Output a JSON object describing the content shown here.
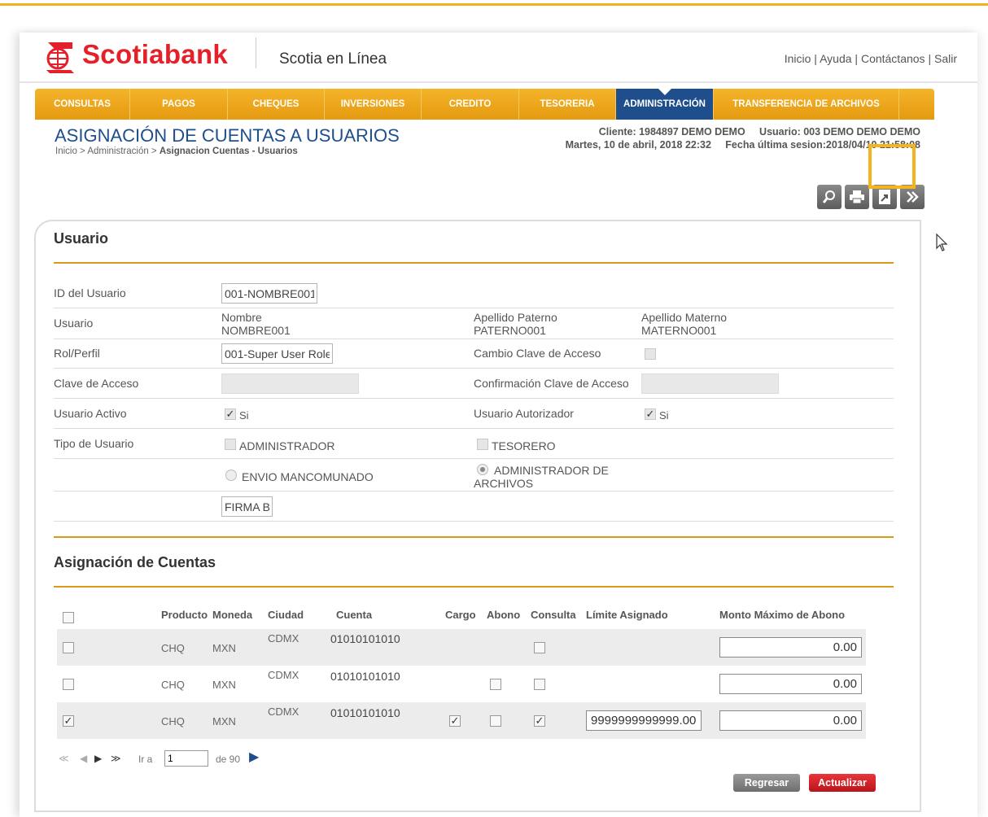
{
  "header": {
    "brand": "Scotiabank",
    "app_title": "Scotia en Línea",
    "links": [
      "Inicio",
      "Ayuda",
      "Contáctanos",
      "Salir"
    ],
    "link_sep": " | "
  },
  "nav": {
    "items": [
      "CONSULTAS",
      "PAGOS",
      "CHEQUES",
      "INVERSIONES",
      "CREDITO",
      "TESORERIA",
      "ADMINISTRACIÓN",
      "TRANSFERENCIA DE ARCHIVOS"
    ],
    "active": "ADMINISTRACIÓN"
  },
  "page": {
    "title": "ASIGNACIÓN DE CUENTAS A USUARIOS",
    "breadcrumb_prefix": "Inicio > Administración > ",
    "breadcrumb_current": "Asignacion Cuentas - Usuarios",
    "session_line1": "Cliente: 1984897 DEMO DEMO     Usuario: 003 DEMO DEMO DEMO",
    "session_line2": "Martes, 10 de abril, 2018 22:32     Fecha última sesion:2018/04/10 21:58:08"
  },
  "toolbar": {
    "icons": [
      "search-icon",
      "print-icon",
      "export-icon",
      "next-icon"
    ]
  },
  "usuario": {
    "section_title": "Usuario",
    "id_label": "ID del Usuario",
    "id_value": "001-NOMBRE001",
    "usuario_label": "Usuario",
    "nombre_label": "Nombre",
    "nombre_value": "NOMBRE001",
    "paterno_label": "Apellido Paterno",
    "paterno_value": "PATERNO001",
    "materno_label": "Apellido Materno",
    "materno_value": "MATERNO001",
    "rol_label": "Rol/Perfil",
    "rol_value": "001-Super User Role",
    "cambio_label": "Cambio Clave de Acceso",
    "clave_label": "Clave de Acceso",
    "confirmacion_label": "Confirmación Clave de Acceso",
    "activo_label": "Usuario Activo",
    "si_label": "Si",
    "autorizador_label": "Usuario Autorizador",
    "tipo_label": "Tipo de Usuario",
    "administrador_label": "ADMINISTRADOR",
    "tesorero_label": "TESORERO",
    "envio_label": "ENVIO MANCOMUNADO",
    "admin_archivos_label_1": "ADMINISTRADOR DE",
    "admin_archivos_label_2": "ARCHIVOS",
    "firma_value": "FIRMA B"
  },
  "cuentas": {
    "section_title": "Asignación de Cuentas",
    "columns": [
      "Producto",
      "Moneda",
      "Ciudad",
      "Cuenta",
      "Cargo",
      "Abono",
      "Consulta",
      "Límite Asignado",
      "Monto Máximo de Abono"
    ],
    "rows": [
      {
        "producto": "CHQ",
        "moneda": "MXN",
        "ciudad": "CDMX",
        "cuenta": "01010101010",
        "monto": "0.00",
        "limite": ""
      },
      {
        "producto": "CHQ",
        "moneda": "MXN",
        "ciudad": "CDMX",
        "cuenta": "01010101010",
        "monto": "0.00",
        "limite": ""
      },
      {
        "producto": "CHQ",
        "moneda": "MXN",
        "ciudad": "CDMX",
        "cuenta": "01010101010",
        "monto": "0.00",
        "limite": "9999999999999.00"
      }
    ]
  },
  "pager": {
    "ir_a": "Ir a",
    "page_value": "1",
    "de_label": "de 90"
  },
  "buttons": {
    "regresar": "Regresar",
    "actualizar": "Actualizar"
  },
  "colors": {
    "brand_red": "#e4202a",
    "nav_orange": "#f0a820",
    "nav_active": "#1f4e8c",
    "highlight": "#f3b51b"
  }
}
